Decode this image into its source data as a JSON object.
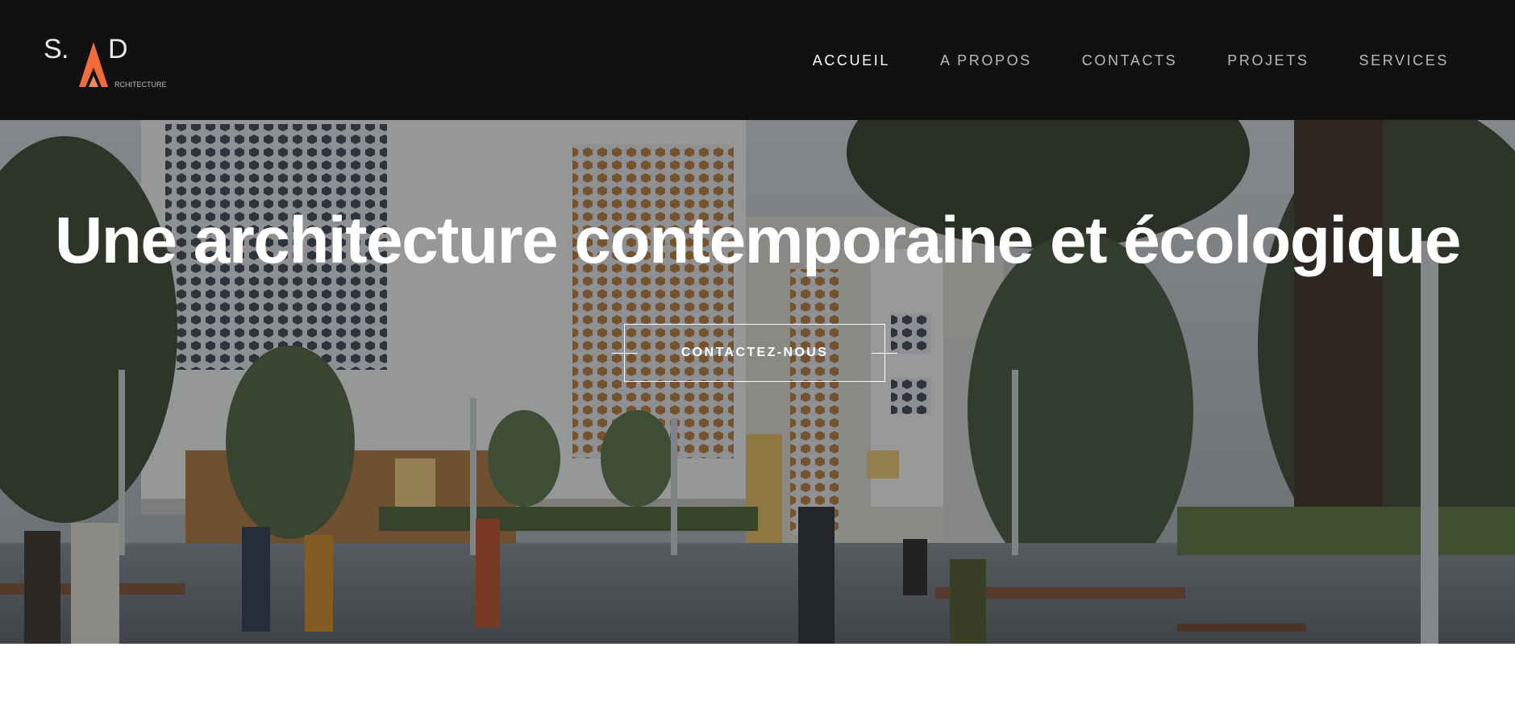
{
  "brand": {
    "logo_letters": "S.AD",
    "logo_caption": "RCHITECTURE",
    "colors": {
      "accent": "#f26b3a",
      "header_bg": "#111111"
    }
  },
  "nav": {
    "items": [
      {
        "label": "ACCUEIL",
        "active": true
      },
      {
        "label": "A PROPOS",
        "active": false
      },
      {
        "label": "CONTACTS",
        "active": false
      },
      {
        "label": "PROJETS",
        "active": false
      },
      {
        "label": "SERVICES",
        "active": false
      }
    ]
  },
  "hero": {
    "title": "Une architecture contemporaine et écologique",
    "cta_label": "CONTACTEZ-NOUS"
  }
}
